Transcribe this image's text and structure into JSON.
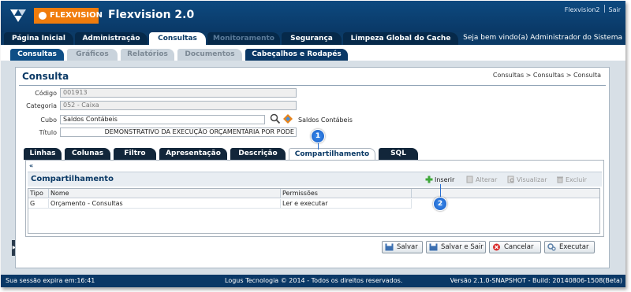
{
  "header": {
    "brand": "FLEXVISION",
    "title": "Flexvision 2.0",
    "user": "Flexvision2",
    "logout": "Sair",
    "welcome": "Seja bem vindo(a) Administrador do Sistema"
  },
  "main_tabs": [
    {
      "label": "Página Inicial",
      "state": "normal"
    },
    {
      "label": "Administração",
      "state": "normal"
    },
    {
      "label": "Consultas",
      "state": "active"
    },
    {
      "label": "Monitoramento",
      "state": "disabled"
    },
    {
      "label": "Segurança",
      "state": "normal"
    },
    {
      "label": "Limpeza Global do Cache",
      "state": "normal"
    }
  ],
  "sub_tabs": [
    {
      "label": "Consultas",
      "state": "active"
    },
    {
      "label": "Gráficos",
      "state": "inactive"
    },
    {
      "label": "Relatórios",
      "state": "inactive"
    },
    {
      "label": "Documentos",
      "state": "inactive"
    },
    {
      "label": "Cabeçalhos e Rodapés",
      "state": "alt"
    }
  ],
  "page": {
    "title": "Consulta",
    "breadcrumb": "Consultas > Consultas > Consulta"
  },
  "form": {
    "codigo_label": "Código",
    "codigo_value": "001913",
    "categoria_label": "Categoria",
    "categoria_value": "052 - Caixa",
    "cubo_label": "Cubo",
    "cubo_value": "Saldos Contábeis",
    "cubo_caption": "Saldos Contábeis",
    "titulo_label": "Título",
    "titulo_value": "DEMONSTRATIVO DA EXECUÇÃO ORÇAMENTÁRIA POR PODE"
  },
  "section_tabs": [
    {
      "label": "Linhas",
      "state": "normal"
    },
    {
      "label": "Colunas",
      "state": "normal"
    },
    {
      "label": "Filtro",
      "state": "normal"
    },
    {
      "label": "Apresentação",
      "state": "normal"
    },
    {
      "label": "Descrição",
      "state": "normal"
    },
    {
      "label": "Compartilhamento",
      "state": "active"
    },
    {
      "label": "SQL",
      "state": "normal"
    }
  ],
  "sharing": {
    "title": "Compartilhamento",
    "toolbar": {
      "insert": "Inserir",
      "edit": "Alterar",
      "view": "Visualizar",
      "delete": "Excluir"
    },
    "columns": [
      "Tipo",
      "Nome",
      "Permissões"
    ],
    "rows": [
      [
        "G",
        "Orçamento - Consultas",
        "Ler e executar"
      ]
    ]
  },
  "callouts": [
    "1",
    "2"
  ],
  "actions": {
    "save": "Salvar",
    "save_exit": "Salvar e Sair",
    "cancel": "Cancelar",
    "execute": "Executar"
  },
  "footer": {
    "session": "Sua sessão expira em:16:41",
    "copyright": "Logus Tecnologia © 2014 - Todos os direitos reservados.",
    "version": "Versão 2.1.0-SNAPSHOT - Build: 20140806-1508(Beta)"
  },
  "colors": {
    "navy": "#0b3a66",
    "brand_orange": "#f07c0c",
    "callout_blue": "#1a5fc4"
  }
}
